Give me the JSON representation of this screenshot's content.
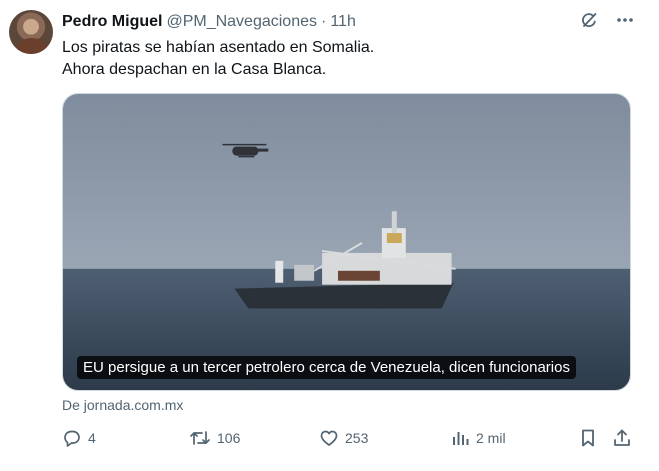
{
  "tweet": {
    "author_name": "Pedro Miguel",
    "author_handle": "@PM_Navegaciones",
    "separator": "·",
    "time": "11h",
    "text_line1": "Los piratas se habían asentado en Somalia.",
    "text_line2": "Ahora despachan en la Casa Blanca.",
    "card_caption": "EU persigue a un tercer petrolero cerca de Venezuela, dicen funcionarios",
    "card_source": "De jornada.com.mx"
  },
  "actions": {
    "replies": "4",
    "reposts": "106",
    "likes": "253",
    "views": "2 mil"
  },
  "icons": {
    "grok": "grok-icon",
    "more": "more-icon",
    "reply": "reply-icon",
    "repost": "repost-icon",
    "like": "like-icon",
    "views": "views-icon",
    "bookmark": "bookmark-icon",
    "share": "share-icon"
  },
  "colors": {
    "text": "#0f1419",
    "muted": "#536471",
    "sky": "#8a97a6",
    "sea": "#3b4a5a"
  }
}
